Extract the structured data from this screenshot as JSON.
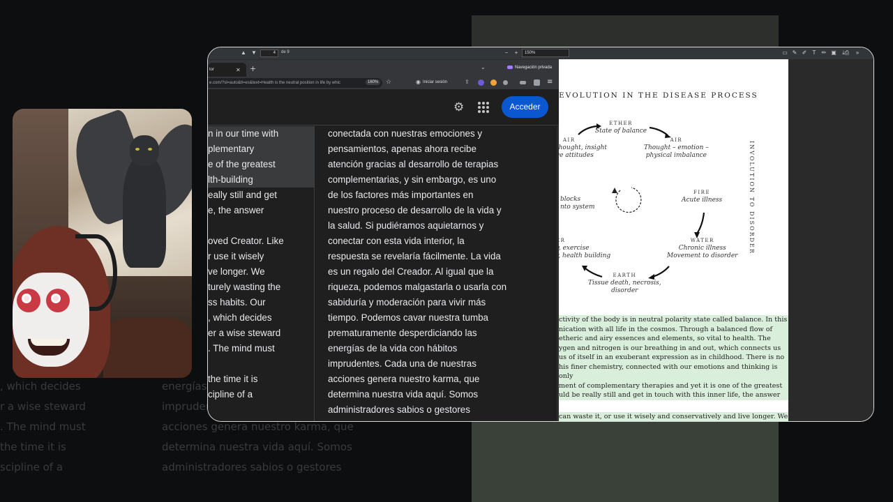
{
  "pdf_toolbar": {
    "page_current": "4",
    "page_of": "de 9",
    "zoom": "150%",
    "zoom_minus": "−",
    "zoom_plus": "+"
  },
  "pdf": {
    "title": "EVOLUTION IN THE DISEASE PROCESS",
    "side_label": "INVOLUTION TO DISORDER",
    "nodes": {
      "ether": {
        "cap": "ETHER",
        "text": "State of balance"
      },
      "air_right": {
        "cap": "AIR",
        "text1": "Thought – emotion –",
        "text2": "physical imbalance"
      },
      "air_left": {
        "cap": "AIR",
        "text1": "thought, insight",
        "text2": "ve attitudes"
      },
      "fire": {
        "cap": "FIRE",
        "text": "Acute illness"
      },
      "water": {
        "cap": "WATER",
        "text1": "Chronic illness",
        "text2": "Movement to disorder"
      },
      "earth": {
        "cap": "EARTH",
        "text1": "Tissue death, necrosis,",
        "text2": "disorder"
      },
      "left_mid1": "blocks",
      "left_mid2": "nto system",
      "left_low_cap": "ER",
      "left_low1": "y, exercise",
      "left_low2": "r, health building"
    },
    "para1": [
      "ctivity of the body is in neutral polarity state called balance. In this",
      "nication with all life in the cosmos. Through a balanced flow of",
      "etheric and airy essences and elements, so vital to health. The",
      "ygen and nitrogen is our breathing in and out, which connects us",
      "us of itself in an exuberant expression as in childhood. There is no",
      "his finer chemistry, connected with our emotions and thinking is only",
      "ment of complementary therapies and yet it is one of the greatest",
      "uld be really still and get in touch with this inner life, the answer"
    ],
    "para2": "can waste it, or use it wisely and conservatively and live longer. We"
  },
  "browser": {
    "tab_title": "tor",
    "private_label": "Navegación privada",
    "url": "e.com/?sl=auto&tl=es&text=Health is the neutral position in life by whic",
    "url_zoom": "160%",
    "signin": "Iniciar sesión",
    "acceder": "Acceder"
  },
  "source_lines": [
    "n in our time with",
    "plementary",
    "e of the greatest",
    "lth-building",
    "eally still and get",
    "e, the answer",
    "",
    "oved Creator. Like",
    "r use it wisely",
    "ve longer. We",
    "turely wasting the",
    "ss habits. Our",
    ", which decides",
    "er a wise steward",
    ". The mind must",
    "",
    " the time it is",
    "cipline of a"
  ],
  "translation_lines": [
    "conectada con nuestras emociones y",
    "pensamientos, apenas ahora recibe",
    "atención gracias al desarrollo de terapias",
    "complementarias, y sin embargo, es uno",
    "de los factores más importantes en",
    "nuestro proceso de desarrollo de la vida y",
    "la salud. Si pudiéramos aquietarnos y",
    "conectar con esta vida interior, la",
    "respuesta se revelaría fácilmente. La vida",
    "es un regalo del Creador. Al igual que la",
    "riqueza, podemos malgastarla o usarla con",
    "sabiduría y moderación para vivir más",
    "tiempo. Podemos cavar nuestra tumba",
    "prematuramente desperdiciando las",
    "energías de la vida con hábitos",
    "imprudentes. Cada una de nuestras",
    "acciones genera nuestro karma, que",
    "determina nuestra vida aquí. Somos",
    "administradores sabios o gestores"
  ],
  "background_lines": [
    ", which decides",
    "r a wise steward",
    ". The mind must",
    "",
    "the time it is",
    "scipline of a"
  ],
  "background_right_lines": [
    "energías de la vida con hábitos",
    "imprudentes. Cada una de nuestras",
    "acciones genera nuestro karma, que",
    "determina nuestra vida aquí. Somos",
    "administradores sabios o gestores"
  ],
  "colors": {
    "accent_button": "#0b57d0",
    "pdf_highlight": "#d9eedb",
    "private_badge": "#a77bff"
  },
  "icons": {
    "settings": "gear-icon",
    "apps": "apps-grid-icon",
    "bookmark": "star-icon"
  }
}
